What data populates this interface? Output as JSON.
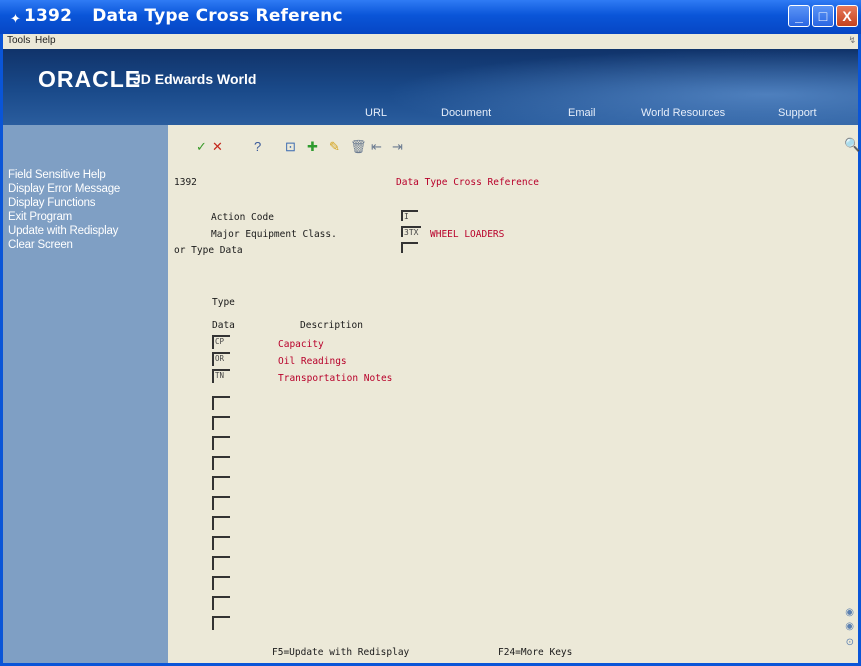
{
  "window": {
    "program_number": "1392",
    "title": "Data Type Cross Referenc",
    "controls": {
      "minimize": "_",
      "maximize": "□",
      "close": "X"
    }
  },
  "menubar": {
    "tools": "Tools",
    "help": "Help"
  },
  "brand": {
    "oracle": "ORACLE",
    "product": "JD Edwards World",
    "nav": [
      "URL",
      "Document",
      "Email",
      "World Resources",
      "Support"
    ]
  },
  "exits": [
    "Field Sensitive Help",
    "Display Error Message",
    "Display Functions",
    "Exit Program",
    "Update with Redisplay",
    "Clear Screen"
  ],
  "toolbar": {
    "icons": [
      "ok-check",
      "cancel-x",
      "help-question",
      "inquire",
      "add-plus",
      "change-pencil",
      "delete-trash",
      "previous-page",
      "next-page"
    ],
    "glyphs": [
      "✓",
      "✕",
      "?",
      "⊡",
      "✚",
      "✎",
      "🗑",
      "⇤",
      "⇥"
    ]
  },
  "form": {
    "program_id": "1392",
    "title": "Data Type Cross Reference",
    "action_code_label": "Action Code",
    "action_code_value": "I",
    "equipment_class_label": "Major Equipment Class.",
    "equipment_class_value": "3TX",
    "equipment_class_desc": "WHEEL LOADERS",
    "type_data_label": "or Type Data",
    "type_data_value": "",
    "col_type": "Type",
    "col_data": "Data",
    "col_description": "Description",
    "rows": [
      {
        "code": "CP",
        "description": "Capacity"
      },
      {
        "code": "OR",
        "description": "Oil Readings"
      },
      {
        "code": "TN",
        "description": "Transportation Notes"
      },
      {
        "code": "",
        "description": ""
      },
      {
        "code": "",
        "description": ""
      },
      {
        "code": "",
        "description": ""
      },
      {
        "code": "",
        "description": ""
      },
      {
        "code": "",
        "description": ""
      },
      {
        "code": "",
        "description": ""
      },
      {
        "code": "",
        "description": ""
      },
      {
        "code": "",
        "description": ""
      },
      {
        "code": "",
        "description": ""
      },
      {
        "code": "",
        "description": ""
      },
      {
        "code": "",
        "description": ""
      },
      {
        "code": "",
        "description": ""
      }
    ],
    "footer_f5": "F5=Update with Redisplay",
    "footer_f24": "F24=More Keys"
  },
  "colors": {
    "titlebar": "#0a55d8",
    "sidebar": "#7f9fc4",
    "panel": "#ece9d8",
    "red_text": "#b8002a"
  }
}
